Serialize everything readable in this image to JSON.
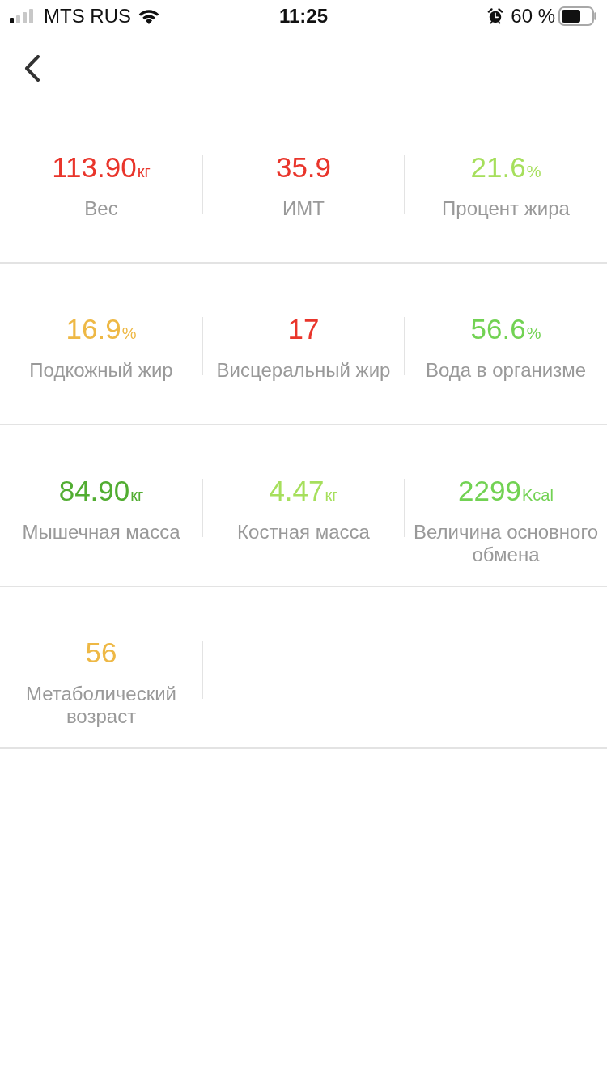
{
  "status_bar": {
    "carrier": "MTS RUS",
    "time": "11:25",
    "battery": "60 %"
  },
  "rows": [
    {
      "metrics": [
        {
          "value": "113.90",
          "unit": "кг",
          "label": "Вес",
          "color": "#e9352b"
        },
        {
          "value": "35.9",
          "label": "ИМТ",
          "color": "#e9352b"
        },
        {
          "value": "21.6",
          "unit": "%",
          "label": "Процент жира",
          "color": "#a6df5c"
        }
      ]
    },
    {
      "metrics": [
        {
          "value": "16.9",
          "unit": "%",
          "label": "Подкожный жир",
          "color": "#eeb845"
        },
        {
          "value": "17",
          "label": "Висцеральный жир",
          "color": "#e9352b"
        },
        {
          "value": "56.6",
          "unit": "%",
          "label": "Вода в организме",
          "color": "#72d253"
        }
      ]
    },
    {
      "metrics": [
        {
          "value": "84.90",
          "unit": "кг",
          "label": "Мышечная масса",
          "color": "#52ad32"
        },
        {
          "value": "4.47",
          "unit": "кг",
          "label": "Костная масса",
          "color": "#a6df5c"
        },
        {
          "value": "2299",
          "unit": "Kcal",
          "label": "Величина основного обмена",
          "color": "#72d253"
        }
      ]
    },
    {
      "metrics": [
        {
          "value": "56",
          "label": "Метаболический возраст",
          "color": "#eeb845"
        }
      ]
    }
  ]
}
